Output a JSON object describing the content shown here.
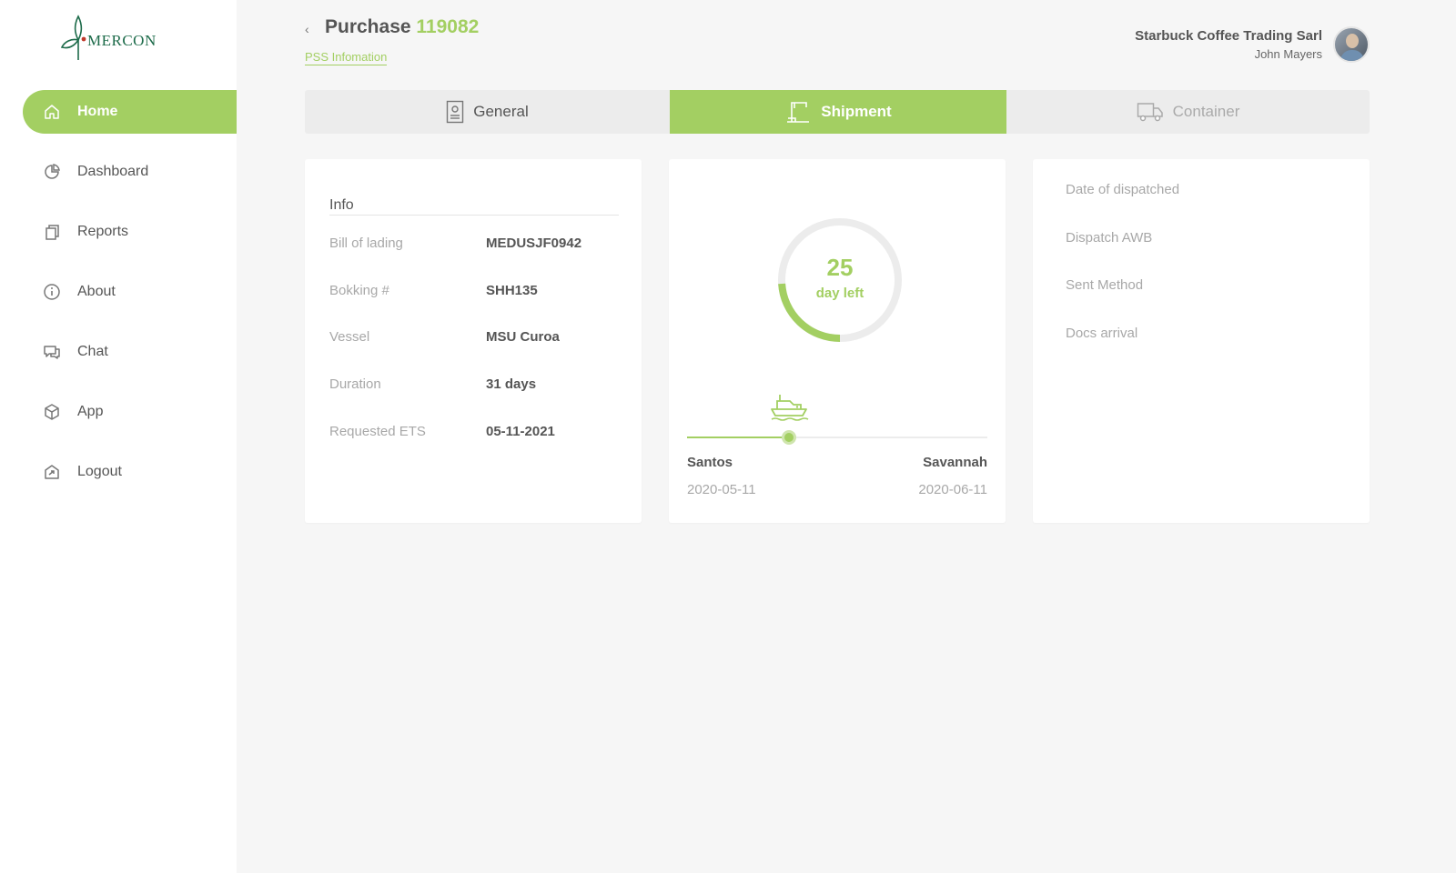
{
  "brand": {
    "name": "MERCON"
  },
  "nav": {
    "items": [
      {
        "label": "Home",
        "icon": "home-icon",
        "active": true
      },
      {
        "label": "Dashboard",
        "icon": "pie-chart-icon"
      },
      {
        "label": "Reports",
        "icon": "copy-icon"
      },
      {
        "label": "About",
        "icon": "info-icon"
      },
      {
        "label": "Chat",
        "icon": "chat-icon"
      },
      {
        "label": "App",
        "icon": "box-icon"
      },
      {
        "label": "Logout",
        "icon": "logout-icon"
      }
    ]
  },
  "header": {
    "back_icon": "‹",
    "title_prefix": "Purchase",
    "title_number": "119082",
    "link": "PSS Infomation"
  },
  "user": {
    "company": "Starbuck Coffee Trading Sarl",
    "name": "John Mayers"
  },
  "tabs": [
    {
      "label": "General",
      "icon": "document-icon"
    },
    {
      "label": "Shipment",
      "icon": "crane-icon",
      "active": true
    },
    {
      "label": "Container",
      "icon": "truck-icon"
    }
  ],
  "info": {
    "heading": "Info",
    "rows": [
      {
        "label": "Bill of lading",
        "value": "MEDUSJF0942"
      },
      {
        "label": "Bokking #",
        "value": "SHH135"
      },
      {
        "label": "Vessel",
        "value": "MSU Curoa"
      },
      {
        "label": "Duration",
        "value": "31 days"
      },
      {
        "label": "Requested ETS",
        "value": "05-11-2021"
      }
    ]
  },
  "progress": {
    "days_left": "25",
    "days_left_label": "day left",
    "ring_fraction": 0.24,
    "route_fraction": 0.34,
    "origin": {
      "port": "Santos",
      "date": "2020-05-11"
    },
    "destination": {
      "port": "Savannah",
      "date": "2020-06-11"
    }
  },
  "docs": {
    "rows": [
      {
        "label": "Date of dispatched"
      },
      {
        "label": "Dispatch AWB"
      },
      {
        "label": "Sent Method"
      },
      {
        "label": "Docs arrival"
      }
    ]
  },
  "colors": {
    "accent": "#a3cf62",
    "text": "#555555",
    "muted": "#a8a8a8",
    "background": "#f6f6f6"
  }
}
